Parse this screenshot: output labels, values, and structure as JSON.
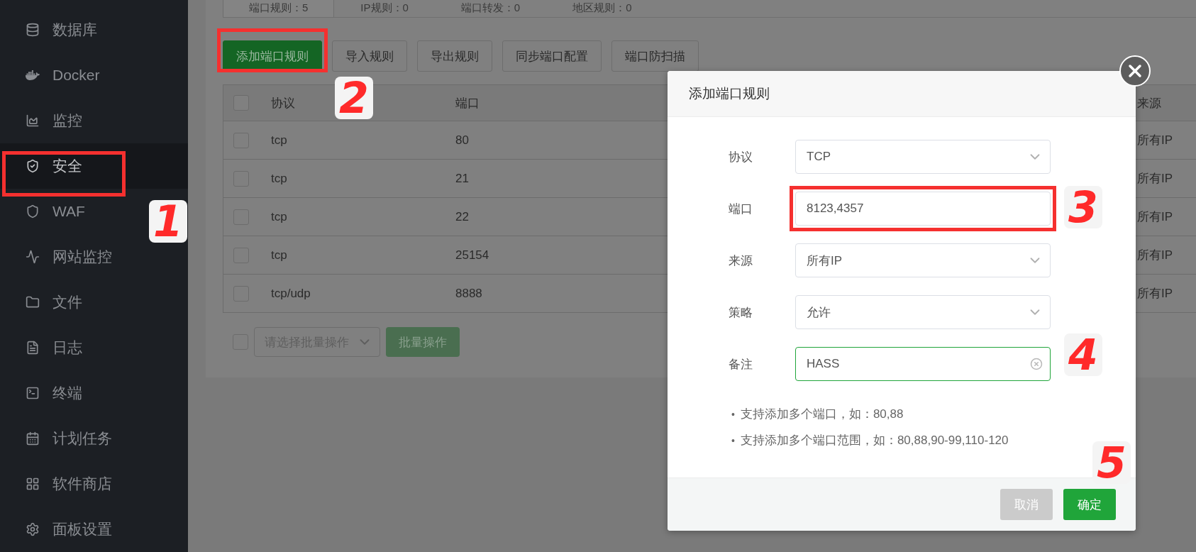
{
  "sidebar": {
    "items": [
      {
        "label": "数据库",
        "selected": false
      },
      {
        "label": "Docker",
        "selected": false
      },
      {
        "label": "监控",
        "selected": false
      },
      {
        "label": "安全",
        "selected": true
      },
      {
        "label": "WAF",
        "selected": false
      },
      {
        "label": "网站监控",
        "selected": false
      },
      {
        "label": "文件",
        "selected": false
      },
      {
        "label": "日志",
        "selected": false
      },
      {
        "label": "终端",
        "selected": false
      },
      {
        "label": "计划任务",
        "selected": false
      },
      {
        "label": "软件商店",
        "selected": false
      },
      {
        "label": "面板设置",
        "selected": false
      }
    ]
  },
  "tabs": [
    {
      "label": "端口规则：5",
      "selected": true
    },
    {
      "label": "IP规则：0",
      "selected": false
    },
    {
      "label": "端口转发：0",
      "selected": false
    },
    {
      "label": "地区规则：0",
      "selected": false
    }
  ],
  "toolbar": {
    "buttons": [
      {
        "label": "添加端口规则",
        "kind": "primary"
      },
      {
        "label": "导入规则",
        "kind": "default"
      },
      {
        "label": "导出规则",
        "kind": "default"
      },
      {
        "label": "同步端口配置",
        "kind": "default"
      },
      {
        "label": "端口防扫描",
        "kind": "default"
      }
    ]
  },
  "table": {
    "header_checked": false,
    "columns": [
      "协议",
      "端口",
      "来源"
    ],
    "rows": [
      {
        "checked": false,
        "protocol": "tcp",
        "port": "80",
        "source": "所有IP"
      },
      {
        "checked": false,
        "protocol": "tcp",
        "port": "21",
        "source": "所有IP"
      },
      {
        "checked": false,
        "protocol": "tcp",
        "port": "22",
        "source": "所有IP"
      },
      {
        "checked": false,
        "protocol": "tcp",
        "port": "25154",
        "source": "所有IP"
      },
      {
        "checked": false,
        "protocol": "tcp/udp",
        "port": "8888",
        "source": "所有IP"
      }
    ]
  },
  "bulk": {
    "checked": false,
    "placeholder": "请选择批量操作",
    "button": "批量操作"
  },
  "dialog": {
    "title": "添加端口规则",
    "fields": [
      {
        "label": "协议",
        "kind": "select",
        "value": "TCP",
        "focused": false
      },
      {
        "label": "端口",
        "kind": "input",
        "value": "8123,4357",
        "focused": false
      },
      {
        "label": "来源",
        "kind": "select",
        "value": "所有IP",
        "focused": false
      },
      {
        "label": "策略",
        "kind": "select",
        "value": "允许",
        "focused": false
      },
      {
        "label": "备注",
        "kind": "input",
        "value": "HASS",
        "focused": true
      }
    ],
    "hints": [
      {
        "marker": "•",
        "text": "支持添加多个端口，如：80,88"
      },
      {
        "marker": "•",
        "text": "支持添加多个端口范围，如：80,88,90-99,110-120"
      }
    ],
    "buttons": [
      {
        "label": "取消",
        "kind": "default"
      },
      {
        "label": "确定",
        "kind": "primary"
      }
    ]
  },
  "annotations": [
    {
      "kind": "box"
    },
    {
      "kind": "box"
    },
    {
      "kind": "box"
    },
    {
      "kind": "digit",
      "text": "1"
    },
    {
      "kind": "digit",
      "text": "2"
    },
    {
      "kind": "digit",
      "text": "3"
    },
    {
      "kind": "digit",
      "text": "4"
    },
    {
      "kind": "digit",
      "text": "5"
    }
  ]
}
